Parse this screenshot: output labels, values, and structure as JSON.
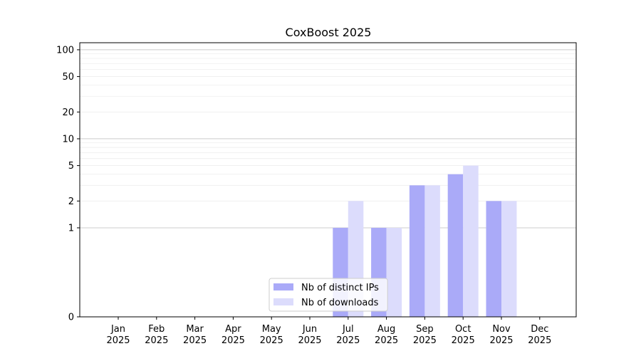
{
  "chart_data": {
    "type": "bar",
    "title": "CoxBoost 2025",
    "xlabel": "",
    "ylabel": "",
    "categories": [
      [
        "Jan",
        "2025"
      ],
      [
        "Feb",
        "2025"
      ],
      [
        "Mar",
        "2025"
      ],
      [
        "Apr",
        "2025"
      ],
      [
        "May",
        "2025"
      ],
      [
        "Jun",
        "2025"
      ],
      [
        "Jul",
        "2025"
      ],
      [
        "Aug",
        "2025"
      ],
      [
        "Sep",
        "2025"
      ],
      [
        "Oct",
        "2025"
      ],
      [
        "Nov",
        "2025"
      ],
      [
        "Dec",
        "2025"
      ]
    ],
    "series": [
      {
        "name": "Nb of distinct IPs",
        "color": "#aaaaf8",
        "values": [
          0,
          0,
          0,
          0,
          0,
          0,
          1,
          1,
          3,
          4,
          2,
          0
        ]
      },
      {
        "name": "Nb of downloads",
        "color": "#dcdcfc",
        "values": [
          0,
          0,
          0,
          0,
          0,
          0,
          2,
          1,
          3,
          5,
          2,
          0
        ]
      }
    ],
    "yscale": "symlog",
    "ylim": [
      0,
      120
    ],
    "yticks": [
      0,
      1,
      2,
      5,
      10,
      20,
      50,
      100
    ],
    "grid": true,
    "legend_position": "bottom-center"
  }
}
